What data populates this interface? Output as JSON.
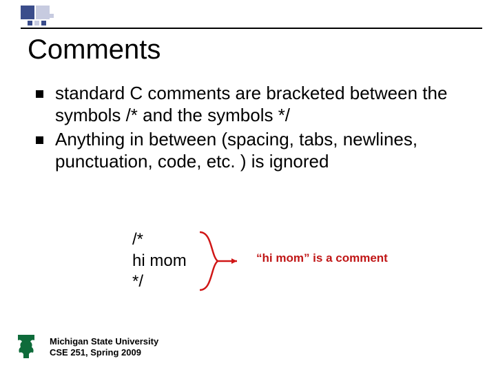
{
  "title": "Comments",
  "bullets": [
    "standard C comments are bracketed between the symbols /* and the symbols */",
    "Anything in between (spacing, tabs, newlines, punctuation, code, etc. ) is ignored"
  ],
  "code": {
    "line1": "/*",
    "line2": "hi mom",
    "line3": "*/"
  },
  "annotation": "“hi mom” is a comment",
  "footer": {
    "line1": "Michigan State University",
    "line2": "CSE 251, Spring 2009"
  }
}
